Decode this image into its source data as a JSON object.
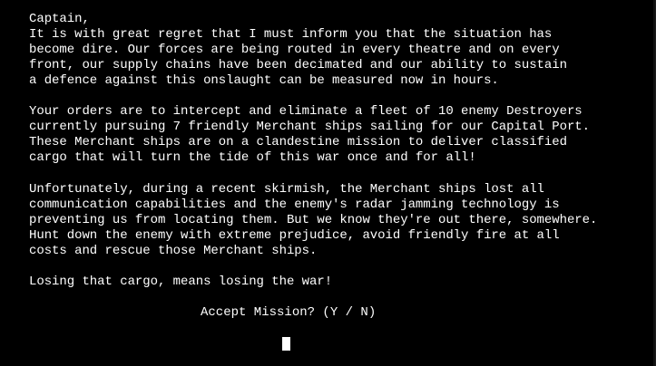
{
  "letter": {
    "salutation": "Captain,",
    "paragraph1": [
      "It is with great regret that I must inform you that the situation has",
      "become dire. Our forces are being routed in every theatre and on every",
      "front, our supply chains have been decimated and our ability to sustain",
      "a defence against this onslaught can be measured now in hours."
    ],
    "paragraph2": [
      "Your orders are to intercept and eliminate a fleet of 10 enemy Destroyers",
      "currently pursuing 7 friendly Merchant ships sailing for our Capital Port.",
      "These Merchant ships are on a clandestine mission to deliver classified",
      "cargo that will turn the tide of this war once and for all!"
    ],
    "paragraph3": [
      "Unfortunately, during a recent skirmish, the Merchant ships lost all",
      "communication capabilities and the enemy's radar jamming technology is",
      "preventing us from locating them. But we know they're out there, somewhere.",
      "Hunt down the enemy with extreme prejudice, avoid friendly fire at all",
      "costs and rescue those Merchant ships."
    ],
    "closing": "Losing that cargo, means losing the war!"
  },
  "prompt": {
    "text": "Accept Mission? (Y / N)"
  },
  "colors": {
    "background": "#000000",
    "text": "#ffffff"
  }
}
